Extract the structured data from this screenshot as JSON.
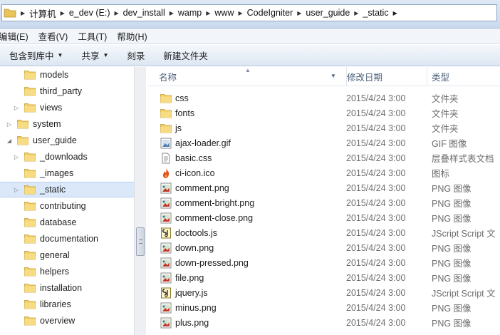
{
  "address": {
    "crumbs": [
      "计算机",
      "e_dev (E:)",
      "dev_install",
      "wamp",
      "www",
      "CodeIgniter",
      "user_guide",
      "_static"
    ]
  },
  "menubar": {
    "items": [
      "编辑(E)",
      "查看(V)",
      "工具(T)",
      "帮助(H)"
    ]
  },
  "toolbar": {
    "include_library": "包含到库中",
    "share": "共享",
    "burn": "刻录",
    "new_folder": "新建文件夹"
  },
  "nav": {
    "items": [
      {
        "label": "models",
        "level": 2,
        "expander": ""
      },
      {
        "label": "third_party",
        "level": 2,
        "expander": ""
      },
      {
        "label": "views",
        "level": 2,
        "expander": "collapsed"
      },
      {
        "label": "system",
        "level": 1,
        "expander": "collapsed"
      },
      {
        "label": "user_guide",
        "level": 1,
        "expander": "expanded"
      },
      {
        "label": "_downloads",
        "level": 2,
        "expander": "collapsed"
      },
      {
        "label": "_images",
        "level": 2,
        "expander": ""
      },
      {
        "label": "_static",
        "level": 2,
        "expander": "collapsed",
        "selected": true
      },
      {
        "label": "contributing",
        "level": 2,
        "expander": ""
      },
      {
        "label": "database",
        "level": 2,
        "expander": ""
      },
      {
        "label": "documentation",
        "level": 2,
        "expander": ""
      },
      {
        "label": "general",
        "level": 2,
        "expander": ""
      },
      {
        "label": "helpers",
        "level": 2,
        "expander": ""
      },
      {
        "label": "installation",
        "level": 2,
        "expander": ""
      },
      {
        "label": "libraries",
        "level": 2,
        "expander": ""
      },
      {
        "label": "overview",
        "level": 2,
        "expander": ""
      }
    ]
  },
  "columns": {
    "name": "名称",
    "date": "修改日期",
    "type": "类型"
  },
  "files": [
    {
      "name": "css",
      "date": "2015/4/24 3:00",
      "type": "文件夹",
      "icon": "folder-icon"
    },
    {
      "name": "fonts",
      "date": "2015/4/24 3:00",
      "type": "文件夹",
      "icon": "folder-icon"
    },
    {
      "name": "js",
      "date": "2015/4/24 3:00",
      "type": "文件夹",
      "icon": "folder-icon"
    },
    {
      "name": "ajax-loader.gif",
      "date": "2015/4/24 3:00",
      "type": "GIF 图像",
      "icon": "gif-file-icon"
    },
    {
      "name": "basic.css",
      "date": "2015/4/24 3:00",
      "type": "层叠样式表文档",
      "icon": "css-file-icon"
    },
    {
      "name": "ci-icon.ico",
      "date": "2015/4/24 3:00",
      "type": "图标",
      "icon": "flame-ico-file-icon"
    },
    {
      "name": "comment.png",
      "date": "2015/4/24 3:00",
      "type": "PNG 图像",
      "icon": "png-file-icon"
    },
    {
      "name": "comment-bright.png",
      "date": "2015/4/24 3:00",
      "type": "PNG 图像",
      "icon": "png-file-icon"
    },
    {
      "name": "comment-close.png",
      "date": "2015/4/24 3:00",
      "type": "PNG 图像",
      "icon": "png-file-icon"
    },
    {
      "name": "doctools.js",
      "date": "2015/4/24 3:00",
      "type": "JScript Script 文",
      "icon": "js-file-icon"
    },
    {
      "name": "down.png",
      "date": "2015/4/24 3:00",
      "type": "PNG 图像",
      "icon": "png-file-icon"
    },
    {
      "name": "down-pressed.png",
      "date": "2015/4/24 3:00",
      "type": "PNG 图像",
      "icon": "png-file-icon"
    },
    {
      "name": "file.png",
      "date": "2015/4/24 3:00",
      "type": "PNG 图像",
      "icon": "png-file-icon"
    },
    {
      "name": "jquery.js",
      "date": "2015/4/24 3:00",
      "type": "JScript Script 文",
      "icon": "js-file-icon"
    },
    {
      "name": "minus.png",
      "date": "2015/4/24 3:00",
      "type": "PNG 图像",
      "icon": "png-file-icon"
    },
    {
      "name": "plus.png",
      "date": "2015/4/24 3:00",
      "type": "PNG 图像",
      "icon": "png-file-icon"
    }
  ],
  "colors": {
    "folder": "#e8c45a",
    "selection": "#dbe8f9",
    "header_text": "#4c607a"
  }
}
